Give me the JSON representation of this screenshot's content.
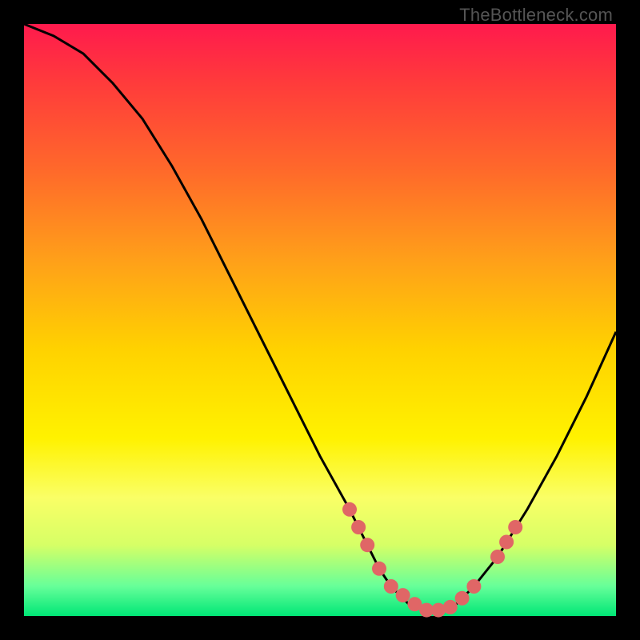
{
  "watermark": "TheBottleneck.com",
  "chart_data": {
    "type": "line",
    "title": "",
    "xlabel": "",
    "ylabel": "",
    "xlim": [
      0,
      100
    ],
    "ylim": [
      0,
      100
    ],
    "curve": {
      "name": "bottleneck-curve",
      "x": [
        0,
        5,
        10,
        15,
        20,
        25,
        30,
        35,
        40,
        45,
        50,
        55,
        58,
        60,
        62,
        65,
        68,
        70,
        73,
        76,
        80,
        85,
        90,
        95,
        100
      ],
      "y": [
        100,
        98,
        95,
        90,
        84,
        76,
        67,
        57,
        47,
        37,
        27,
        18,
        12,
        8,
        5,
        2,
        1,
        1,
        2,
        5,
        10,
        18,
        27,
        37,
        48
      ]
    },
    "markers": {
      "name": "valley-points",
      "color": "#e06666",
      "x": [
        55,
        56.5,
        58,
        60,
        62,
        64,
        66,
        68,
        70,
        72,
        74,
        76,
        80,
        81.5,
        83
      ],
      "y": [
        18,
        15,
        12,
        8,
        5,
        3.5,
        2,
        1,
        1,
        1.5,
        3,
        5,
        10,
        12.5,
        15
      ]
    }
  }
}
